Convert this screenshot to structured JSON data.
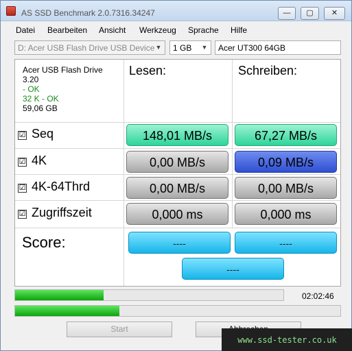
{
  "window": {
    "title": "AS SSD Benchmark 2.0.7316.34247",
    "btn_min": "—",
    "btn_max": "▢",
    "btn_close": "✕"
  },
  "menu": [
    "Datei",
    "Bearbeiten",
    "Ansicht",
    "Werkzeug",
    "Sprache",
    "Hilfe"
  ],
  "toolbar": {
    "device": "D: Acer USB Flash Drive USB Device",
    "size": "1 GB",
    "name": "Acer UT300 64GB"
  },
  "info": {
    "drive": "Acer USB Flash Drive",
    "firmware": "3.20",
    "align1": " - OK",
    "align2": "32 K - OK",
    "capacity": "59,06 GB"
  },
  "headers": {
    "read": "Lesen:",
    "write": "Schreiben:"
  },
  "rows": [
    {
      "label": "Seq",
      "read": "148,01 MB/s",
      "write": "67,27 MB/s"
    },
    {
      "label": "4K",
      "read": "0,00 MB/s",
      "write": "0,09 MB/s"
    },
    {
      "label": "4K-64Thrd",
      "read": "0,00 MB/s",
      "write": "0,00 MB/s"
    },
    {
      "label": "Zugriffszeit",
      "read": "0,000 ms",
      "write": "0,000 ms"
    }
  ],
  "checkbox_mark": "☑",
  "score": {
    "label": "Score:",
    "read": "----",
    "write": "----",
    "total": "----"
  },
  "progress": {
    "bar1": 0.33,
    "bar2": 0.32,
    "time": "02:02:46"
  },
  "buttons": {
    "start": "Start",
    "cancel": "Abbrechen"
  },
  "watermark": "www.ssd-tester.co.uk",
  "colors": {
    "seq_green": "#2fd49a",
    "blue_write": "#2f4fd0",
    "score_cyan": "#16b6ea",
    "progress_green": "#0da40d"
  }
}
